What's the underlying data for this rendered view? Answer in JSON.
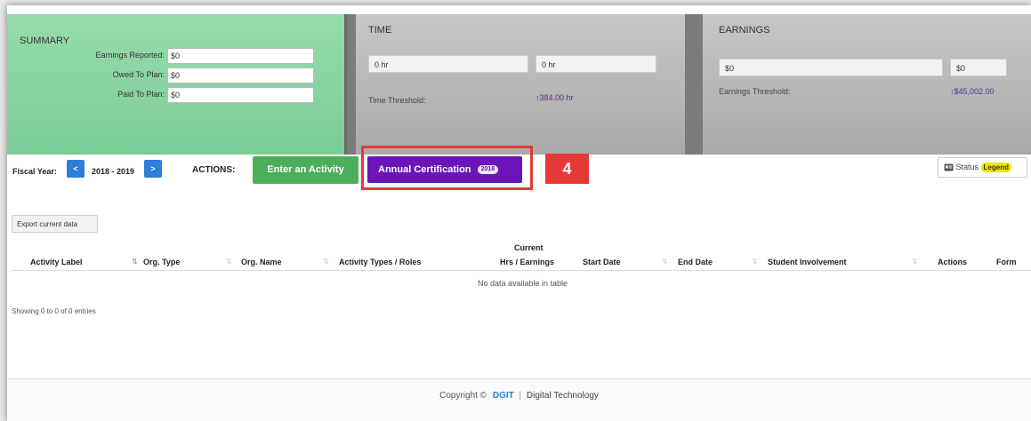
{
  "summary": {
    "title": "SUMMARY",
    "rows": [
      {
        "label": "Earnings Reported:",
        "value": "$0"
      },
      {
        "label": "Owed To Plan:",
        "value": "$0"
      },
      {
        "label": "Paid To Plan:",
        "value": "$0"
      }
    ]
  },
  "time": {
    "title": "TIME",
    "value1": "0 hr",
    "value2": "0 hr",
    "threshold_label": "Time Threshold:",
    "threshold_value": "↑384.00 hr"
  },
  "earnings": {
    "title": "EARNINGS",
    "value1": "$0",
    "value2": "$0",
    "threshold_label": "Earnings Threshold:",
    "threshold_value": "↑$45,002.00"
  },
  "toolbar": {
    "fiscal_year_label": "Fiscal Year:",
    "prev_label": "<",
    "fiscal_year": "2018 - 2019",
    "next_label": ">",
    "actions_label": "ACTIONS:",
    "enter_activity": "Enter an Activity",
    "annual_certification": "Annual Certification",
    "annual_badge": "2018",
    "step_number": "4",
    "status_label": "Status",
    "legend_label": "Legend",
    "export_label": "Export current data"
  },
  "table": {
    "columns": [
      "Activity Label",
      "Org. Type",
      "Org. Name",
      "Activity Types / Roles",
      "Current",
      "Hrs / Earnings",
      "Start Date",
      "End Date",
      "Student Involvement",
      "Actions",
      "Form"
    ],
    "empty_message": "No data available in table",
    "showing": "Showing 0 to 0 of 0 entries"
  },
  "footer": {
    "copyright": "Copyright ©",
    "brand": "DGIT",
    "company": "Digital Technology"
  },
  "colors": {
    "summary_bg": "#8fd6a6",
    "panel_bg": "#b8b8b8",
    "primary_blue": "#2b7fd6",
    "activity_green": "#4cae5a",
    "certification_purple": "#6b14b8",
    "highlight_red": "#e53935",
    "legend_yellow": "#f5e300"
  },
  "icons": {
    "status": "status-card-icon",
    "threshold": "arrow-up-icon"
  }
}
